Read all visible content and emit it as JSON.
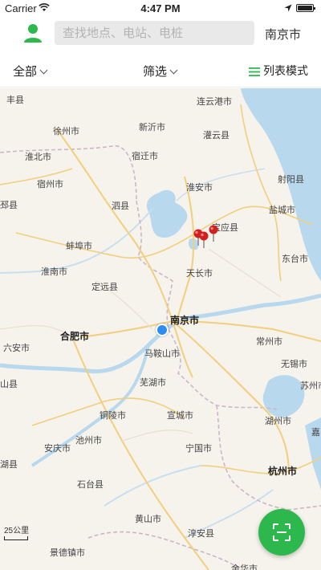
{
  "status_bar": {
    "carrier": "Carrier",
    "time": "4:47 PM"
  },
  "header": {
    "search_placeholder": "查找地点、电站、电桩",
    "city": "南京市"
  },
  "filters": {
    "all_label": "全部",
    "filter_label": "筛选",
    "list_mode_label": "列表模式"
  },
  "map": {
    "labels": [
      {
        "text": "连云港市",
        "cls": ""
      },
      {
        "text": "徐州市",
        "cls": ""
      },
      {
        "text": "新沂市",
        "cls": ""
      },
      {
        "text": "灌云县",
        "cls": ""
      },
      {
        "text": "宿迁市",
        "cls": ""
      },
      {
        "text": "淮北市",
        "cls": ""
      },
      {
        "text": "淮安市",
        "cls": ""
      },
      {
        "text": "射阳县",
        "cls": ""
      },
      {
        "text": "宿州市",
        "cls": ""
      },
      {
        "text": "泗县",
        "cls": ""
      },
      {
        "text": "盐城市",
        "cls": ""
      },
      {
        "text": "宝应县",
        "cls": ""
      },
      {
        "text": "蚌埠市",
        "cls": ""
      },
      {
        "text": "东台市",
        "cls": ""
      },
      {
        "text": "淮南市",
        "cls": ""
      },
      {
        "text": "天长市",
        "cls": ""
      },
      {
        "text": "定远县",
        "cls": ""
      },
      {
        "text": "南京市",
        "cls": "big"
      },
      {
        "text": "合肥市",
        "cls": "big"
      },
      {
        "text": "常州市",
        "cls": ""
      },
      {
        "text": "六安市",
        "cls": ""
      },
      {
        "text": "马鞍山市",
        "cls": ""
      },
      {
        "text": "无锡市",
        "cls": ""
      },
      {
        "text": "芜湖市",
        "cls": ""
      },
      {
        "text": "苏州市",
        "cls": ""
      },
      {
        "text": "铜陵市",
        "cls": ""
      },
      {
        "text": "宣城市",
        "cls": ""
      },
      {
        "text": "湖州市",
        "cls": ""
      },
      {
        "text": "安庆市",
        "cls": ""
      },
      {
        "text": "池州市",
        "cls": ""
      },
      {
        "text": "宁国市",
        "cls": ""
      },
      {
        "text": "石台县",
        "cls": ""
      },
      {
        "text": "杭州市",
        "cls": "big"
      },
      {
        "text": "黄山市",
        "cls": ""
      },
      {
        "text": "淳安县",
        "cls": ""
      },
      {
        "text": "景德镇市",
        "cls": ""
      },
      {
        "text": "金华市",
        "cls": ""
      },
      {
        "text": "丰县",
        "cls": ""
      },
      {
        "text": "邳县",
        "cls": ""
      },
      {
        "text": "山县",
        "cls": ""
      },
      {
        "text": "湖县",
        "cls": ""
      },
      {
        "text": "嘉",
        "cls": ""
      }
    ],
    "scale_label": "25公里",
    "pin_color": "#d21f1f",
    "user_location_color": "#2d8cf0"
  },
  "scan_button": {
    "color": "#2db84d",
    "icon": "scan-icon"
  },
  "colors": {
    "accent": "#2db84d"
  }
}
